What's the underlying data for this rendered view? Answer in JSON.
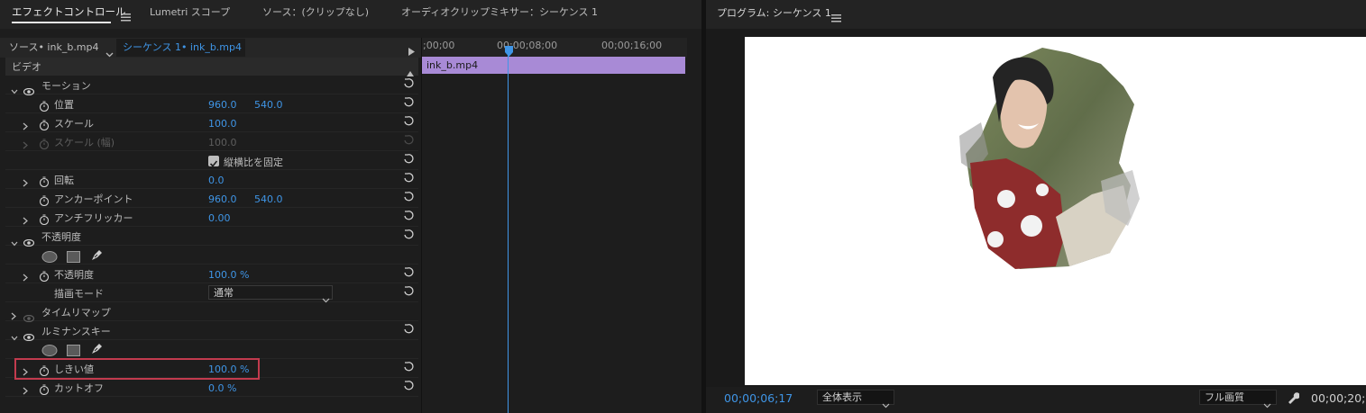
{
  "tabs": [
    {
      "label": "エフェクトコントロール",
      "active": true
    },
    {
      "label": "Lumetri スコープ",
      "active": false
    },
    {
      "label": "ソース：(クリップなし)",
      "active": false
    },
    {
      "label": "オーディオクリップミキサー：シーケンス 1",
      "active": false
    }
  ],
  "program_tab": "プログラム: シーケンス 1",
  "clip_selector": {
    "source": "ソース• ink_b.mp4",
    "sequence": "シーケンス 1• ink_b.mp4"
  },
  "timeline": {
    "ruler_labels": [
      ";00;00",
      "00;00;08;00",
      "00;00;16;00"
    ],
    "clip_name": "ink_b.mp4",
    "clip_color": "#a88ad6",
    "playhead_color": "#3f95e6"
  },
  "section_video": "ビデオ",
  "effects": {
    "motion": {
      "name": "モーション",
      "position": {
        "label": "位置",
        "x": "960.0",
        "y": "540.0"
      },
      "scale": {
        "label": "スケール",
        "value": "100.0"
      },
      "scale_width": {
        "label": "スケール (幅)",
        "value": "100.0"
      },
      "uniform_scale": {
        "label": "縦横比を固定",
        "checked": true
      },
      "rotation": {
        "label": "回転",
        "value": "0.0"
      },
      "anchor": {
        "label": "アンカーポイント",
        "x": "960.0",
        "y": "540.0"
      },
      "antiflicker": {
        "label": "アンチフリッカー",
        "value": "0.00"
      }
    },
    "opacity": {
      "name": "不透明度",
      "opacity": {
        "label": "不透明度",
        "value": "100.0 %"
      },
      "blend_mode": {
        "label": "描画モード",
        "value": "通常"
      }
    },
    "time_remap": {
      "name": "タイムリマップ"
    },
    "luminance_key": {
      "name": "ルミナンスキー",
      "threshold": {
        "label": "しきい値",
        "value": "100.0 %"
      },
      "cutoff": {
        "label": "カットオフ",
        "value": "0.0 %"
      }
    }
  },
  "program": {
    "timecode": "00;00;06;17",
    "zoom": "全体表示",
    "quality": "フル画質",
    "duration": "00;00;20;"
  },
  "highlight_color": "#c23b4e",
  "accent_color": "#3f95e6"
}
